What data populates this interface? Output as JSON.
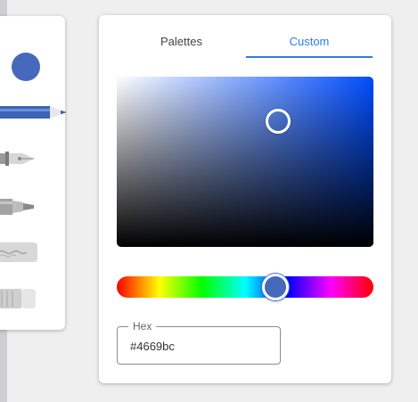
{
  "toolbar": {
    "current_color": "#4669bc",
    "tools": [
      "pen",
      "fountain-pen",
      "marker",
      "pencil",
      "eraser"
    ]
  },
  "tabs": [
    {
      "label": "Palettes",
      "selected": false
    },
    {
      "label": "Custom",
      "selected": true
    }
  ],
  "picker": {
    "hue_degrees": 222,
    "saturation": 0.63,
    "value": 0.74
  },
  "hex": {
    "label": "Hex",
    "value": "#4669bc"
  },
  "colors": {
    "accent": "#2e7be6",
    "selected_color": "#4669bc"
  }
}
